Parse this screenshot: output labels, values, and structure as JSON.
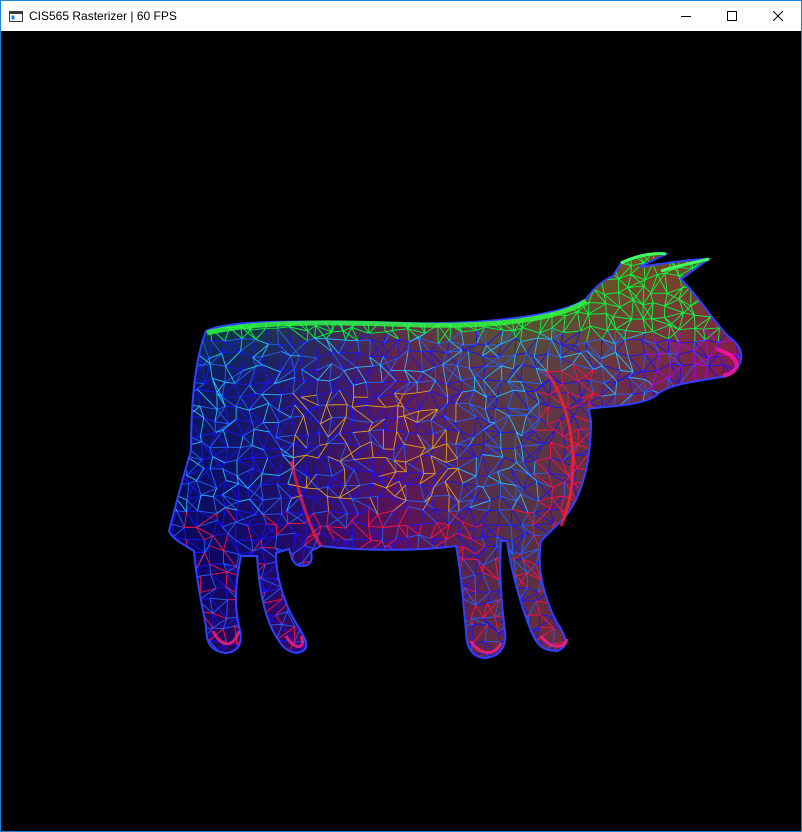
{
  "window": {
    "title": "CIS565 Rasterizer | 60 FPS",
    "icon": "console-window-icon",
    "controls": [
      "minimize-icon",
      "maximize-icon",
      "close-icon"
    ],
    "border_color": "#1883d7"
  },
  "viewport": {
    "background": "#000000",
    "content": "wireframe cow model with normal-based rainbow coloring",
    "palette": [
      "#00ff40",
      "#2060ff",
      "#1a10ff",
      "#ff1040",
      "#e0a020",
      "#20c0ff",
      "#b000ff"
    ]
  }
}
